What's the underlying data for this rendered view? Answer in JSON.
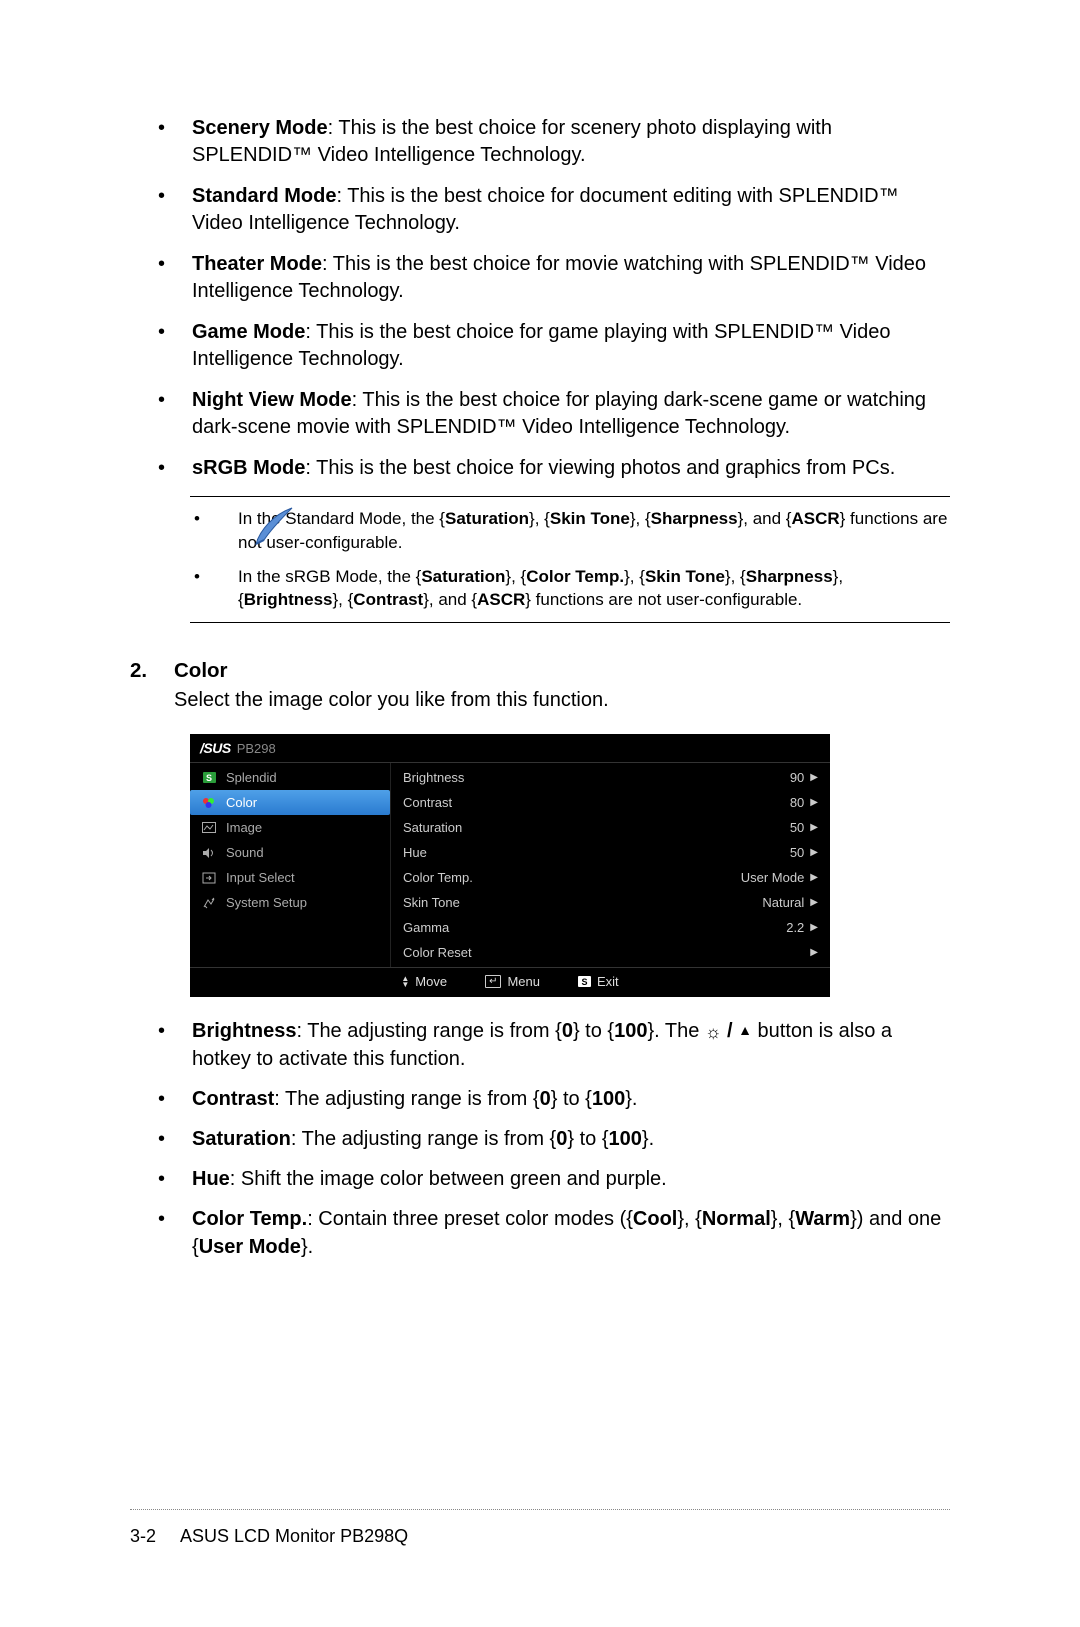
{
  "modes": [
    {
      "name": "Scenery Mode",
      "desc": ": This is the best choice for scenery photo displaying with SPLENDID™ Video Intelligence Technology."
    },
    {
      "name": "Standard Mode",
      "desc": ": This is the best choice for document editing with SPLENDID™ Video Intelligence Technology."
    },
    {
      "name": "Theater Mode",
      "desc": ": This is the best choice for movie watching with SPLENDID™ Video Intelligence Technology."
    },
    {
      "name": "Game Mode",
      "desc": ": This is the best choice for game playing with SPLENDID™ Video Intelligence Technology."
    },
    {
      "name": "Night View Mode",
      "desc": ": This is the best choice for playing dark-scene game or watching dark-scene movie with SPLENDID™ Video Intelligence Technology."
    },
    {
      "name": "sRGB Mode",
      "desc": ": This is the best choice for viewing photos and graphics from PCs."
    }
  ],
  "notes": {
    "n1_pre": "In the Standard Mode, the {",
    "n1_b1": "Saturation",
    "n1_m1": "}, {",
    "n1_b2": "Skin Tone",
    "n1_m2": "}, {",
    "n1_b3": "Sharpness",
    "n1_m3": "}, and {",
    "n1_b4": "ASCR",
    "n1_post": "} functions are not user-configurable.",
    "n2_pre": "In the sRGB Mode, the {",
    "n2_b1": "Saturation",
    "n2_m1": "}, {",
    "n2_b2": "Color Temp.",
    "n2_m2": "}, {",
    "n2_b3": "Skin Tone",
    "n2_m3": "}, {",
    "n2_b4": "Sharpness",
    "n2_m4": "}, {",
    "n2_b5": "Brightness",
    "n2_m5": "}, {",
    "n2_b6": "Contrast",
    "n2_m6": "}, and {",
    "n2_b7": "ASCR",
    "n2_post": "} functions are not user-configurable."
  },
  "section": {
    "num": "2.",
    "title": "Color",
    "desc": "Select the image color you like from this function."
  },
  "osd": {
    "logo": "/SUS",
    "model": "PB298",
    "menu": {
      "splendid": "Splendid",
      "color": "Color",
      "image": "Image",
      "sound": "Sound",
      "input": "Input Select",
      "system": "System Setup"
    },
    "settings": [
      {
        "label": "Brightness",
        "value": "90"
      },
      {
        "label": "Contrast",
        "value": "80"
      },
      {
        "label": "Saturation",
        "value": "50"
      },
      {
        "label": "Hue",
        "value": "50"
      },
      {
        "label": "Color Temp.",
        "value": "User Mode"
      },
      {
        "label": "Skin Tone",
        "value": "Natural"
      },
      {
        "label": "Gamma",
        "value": "2.2"
      },
      {
        "label": "Color Reset",
        "value": ""
      }
    ],
    "footer": {
      "move": "Move",
      "menu": "Menu",
      "exit": "Exit"
    }
  },
  "details": {
    "brightness_name": "Brightness",
    "brightness_t1": ": The adjusting range is from {",
    "brightness_b1": "0",
    "brightness_t2": "} to {",
    "brightness_b2": "100",
    "brightness_t3": "}. The ",
    "brightness_t4": " button is also a hotkey to activate this function.",
    "contrast_name": "Contrast",
    "contrast_t1": ": The adjusting range is from {",
    "contrast_b1": "0",
    "contrast_t2": "} to {",
    "contrast_b2": "100",
    "contrast_t3": "}.",
    "saturation_name": "Saturation",
    "saturation_t1": ": The adjusting range is from {",
    "saturation_b1": "0",
    "saturation_t2": "} to {",
    "saturation_b2": "100",
    "saturation_t3": "}.",
    "hue_name": "Hue",
    "hue_t1": ": Shift the image color between green and purple.",
    "colortemp_name": "Color Temp.",
    "colortemp_t1": ": Contain three preset color modes ({",
    "colortemp_b1": "Cool",
    "colortemp_t2": "}, {",
    "colortemp_b2": "Normal",
    "colortemp_t3": "}, {",
    "colortemp_b3": "Warm",
    "colortemp_t4": "}) and one {",
    "colortemp_b4": "User Mode",
    "colortemp_t5": "}."
  },
  "footer": {
    "pagenum": "3-2",
    "title": "ASUS LCD Monitor PB298Q"
  }
}
